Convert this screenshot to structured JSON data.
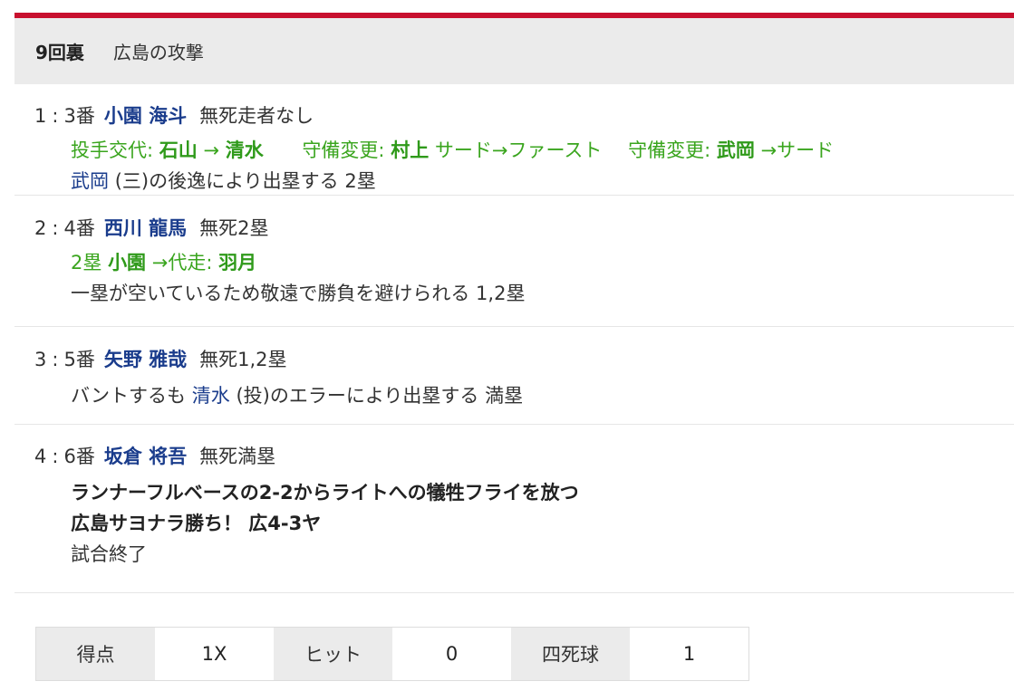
{
  "header": {
    "inning": "9回裏",
    "team_attack": "広島の攻撃"
  },
  "plays": [
    {
      "num": "1",
      "order": "3番",
      "batter": "小園 海斗",
      "situation": "無死走者なし",
      "sub1_label": "投手交代:",
      "sub1_from": "石山",
      "sub1_arrow": "→",
      "sub1_to": "清水",
      "sub2_label": "守備変更:",
      "sub2_player": "村上",
      "sub2_change": "サード→ファースト",
      "sub3_label": "守備変更:",
      "sub3_player": "武岡",
      "sub3_change": "→サード",
      "result_player": "武岡",
      "result_text": "(三)の後逸により出塁する 2塁"
    },
    {
      "num": "2",
      "order": "4番",
      "batter": "西川 龍馬",
      "situation": "無死2塁",
      "sub_base": "2塁",
      "sub_from": "小園",
      "sub_label": "→代走:",
      "sub_to": "羽月",
      "result_text": "一塁が空いているため敬遠で勝負を避けられる 1,2塁"
    },
    {
      "num": "3",
      "order": "5番",
      "batter": "矢野 雅哉",
      "situation": "無死1,2塁",
      "result_pre": "バントするも",
      "result_player": "清水",
      "result_text": "(投)のエラーにより出塁する 満塁"
    },
    {
      "num": "4",
      "order": "6番",
      "batter": "坂倉 将吾",
      "situation": "無死満塁",
      "highlight1": "ランナーフルベースの2-2からライトへの犠牲フライを放つ",
      "highlight2": "広島サヨナラ勝ち！ 広4-3ヤ",
      "result_text": "試合終了"
    }
  ],
  "summary": {
    "runs_label": "得点",
    "runs": "1X",
    "hits_label": "ヒット",
    "hits": "0",
    "walks_label": "四死球",
    "walks": "1"
  },
  "colors": {
    "accent": "#c8102e",
    "player": "#1a3c8c",
    "substitution": "#3aa51e"
  }
}
